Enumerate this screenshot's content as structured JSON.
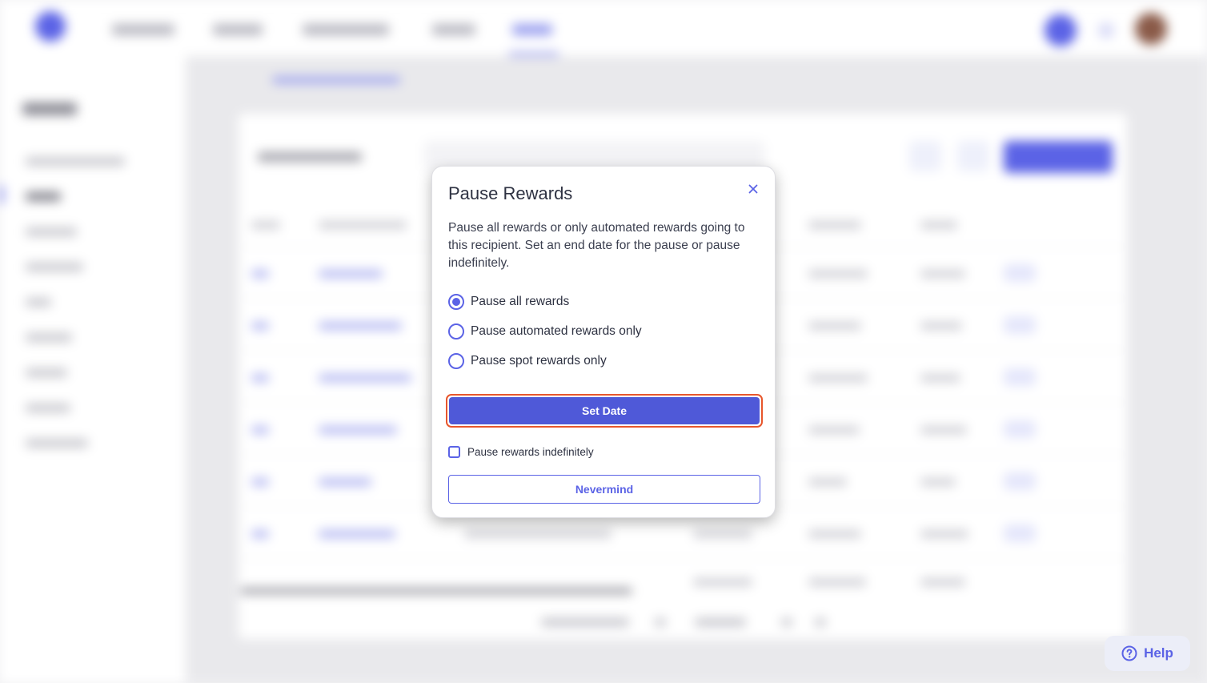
{
  "modal": {
    "title": "Pause Rewards",
    "description": "Pause all rewards or only automated rewards going to this recipient. Set an end date for the pause or pause indefinitely.",
    "options": [
      {
        "label": "Pause all rewards",
        "selected": true
      },
      {
        "label": "Pause automated rewards only",
        "selected": false
      },
      {
        "label": "Pause spot rewards only",
        "selected": false
      }
    ],
    "set_date_label": "Set Date",
    "indefinite_label": "Pause rewards indefinitely",
    "indefinite_checked": false,
    "nevermind_label": "Nevermind",
    "close_icon": "close-icon"
  },
  "help": {
    "label": "Help",
    "icon": "question-circle-icon"
  },
  "colors": {
    "accent": "#5b63e6",
    "primary_button": "#4f59d8",
    "focus_ring": "#e8562c"
  }
}
